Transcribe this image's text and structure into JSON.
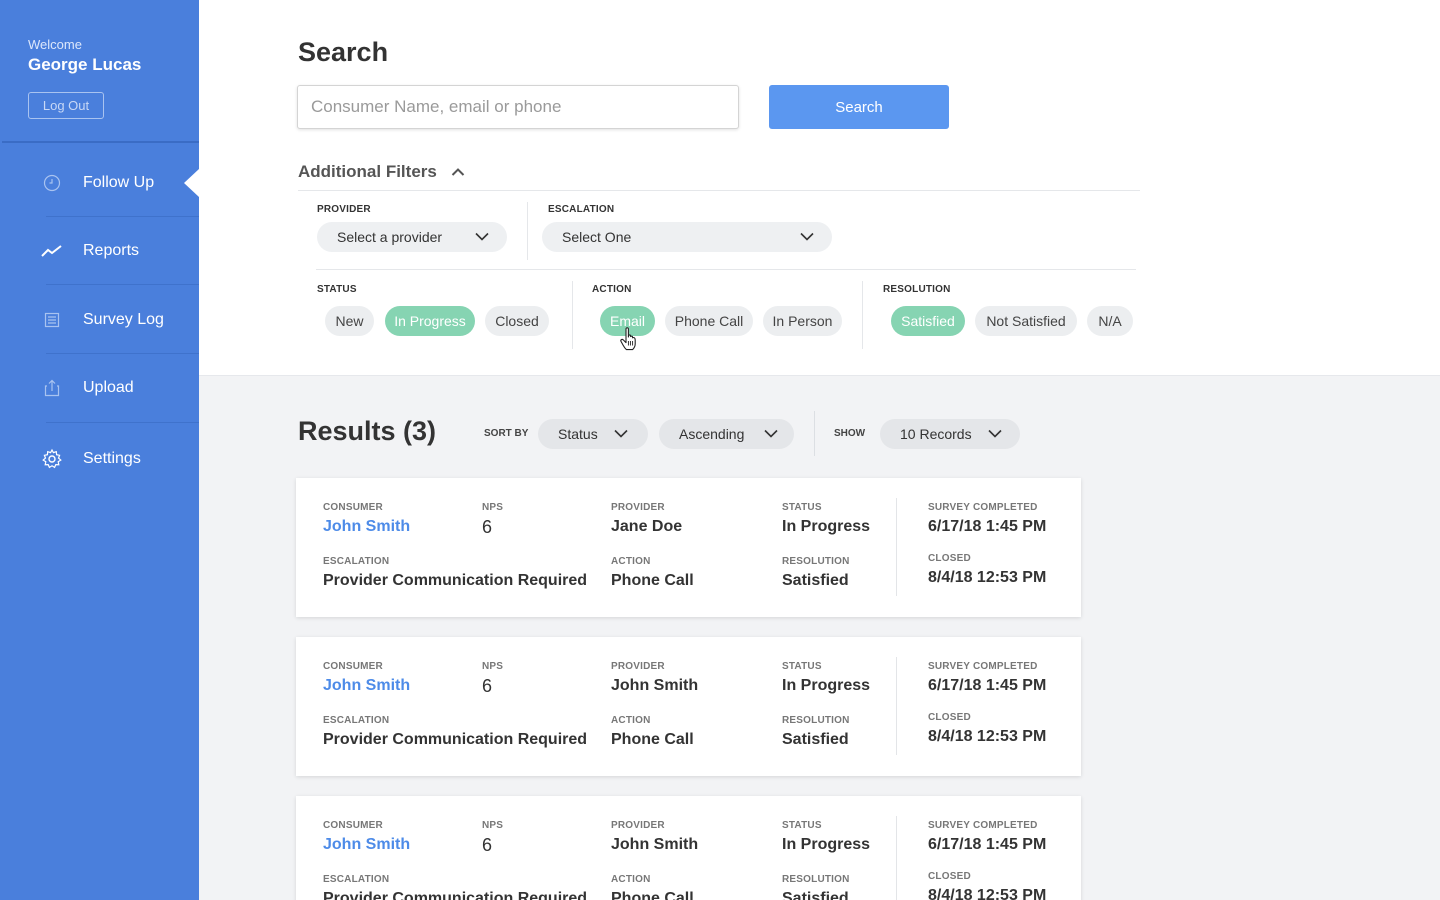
{
  "sidebar": {
    "welcome": "Welcome",
    "user_name": "George Lucas",
    "logout_label": "Log Out",
    "items": [
      {
        "label": "Follow Up",
        "icon": "clock-icon",
        "active": true
      },
      {
        "label": "Reports",
        "icon": "trend-line-icon",
        "active": false
      },
      {
        "label": "Survey Log",
        "icon": "list-icon",
        "active": false
      },
      {
        "label": "Upload",
        "icon": "upload-icon",
        "active": false
      },
      {
        "label": "Settings",
        "icon": "gear-icon",
        "active": false
      }
    ]
  },
  "search": {
    "title": "Search",
    "placeholder": "Consumer Name, email or phone",
    "button_label": "Search"
  },
  "filters": {
    "title": "Additional Filters",
    "provider": {
      "label": "PROVIDER",
      "value": "Select a provider"
    },
    "escalation": {
      "label": "ESCALATION",
      "value": "Select One"
    },
    "status": {
      "label": "STATUS",
      "options": [
        "New",
        "In Progress",
        "Closed"
      ],
      "selected": "In Progress"
    },
    "action": {
      "label": "ACTION",
      "options": [
        "Email",
        "Phone Call",
        "In Person"
      ],
      "selected": "Email"
    },
    "resolution": {
      "label": "RESOLUTION",
      "options": [
        "Satisfied",
        "Not Satisfied",
        "N/A"
      ],
      "selected": "Satisfied"
    }
  },
  "results": {
    "title": "Results (3)",
    "sort_by_label": "SORT BY",
    "sort_field": "Status",
    "sort_order": "Ascending",
    "show_label": "SHOW",
    "show_value": "10 Records",
    "labels": {
      "consumer": "CONSUMER",
      "nps": "NPS",
      "provider": "PROVIDER",
      "status": "STATUS",
      "survey_completed": "SURVEY COMPLETED",
      "escalation": "ESCALATION",
      "action": "ACTION",
      "resolution": "RESOLUTION",
      "closed": "CLOSED"
    },
    "cards": [
      {
        "consumer": "John Smith",
        "nps": "6",
        "provider": "Jane Doe",
        "status": "In Progress",
        "survey_completed": "6/17/18 1:45 PM",
        "escalation": "Provider Communication Required",
        "action": "Phone Call",
        "resolution": "Satisfied",
        "closed": "8/4/18 12:53 PM"
      },
      {
        "consumer": "John Smith",
        "nps": "6",
        "provider": "John Smith",
        "status": "In Progress",
        "survey_completed": "6/17/18 1:45 PM",
        "escalation": "Provider Communication Required",
        "action": "Phone Call",
        "resolution": "Satisfied",
        "closed": "8/4/18 12:53 PM"
      },
      {
        "consumer": "John Smith",
        "nps": "6",
        "provider": "John Smith",
        "status": "In Progress",
        "survey_completed": "6/17/18 1:45 PM",
        "escalation": "Provider Communication Required",
        "action": "Phone Call",
        "resolution": "Satisfied",
        "closed": "8/4/18 12:53 PM"
      }
    ]
  },
  "colors": {
    "sidebar": "#4a7fdc",
    "primary_button": "#5b97f0",
    "selected_pill": "#86d4b2",
    "link": "#4d8be8"
  }
}
